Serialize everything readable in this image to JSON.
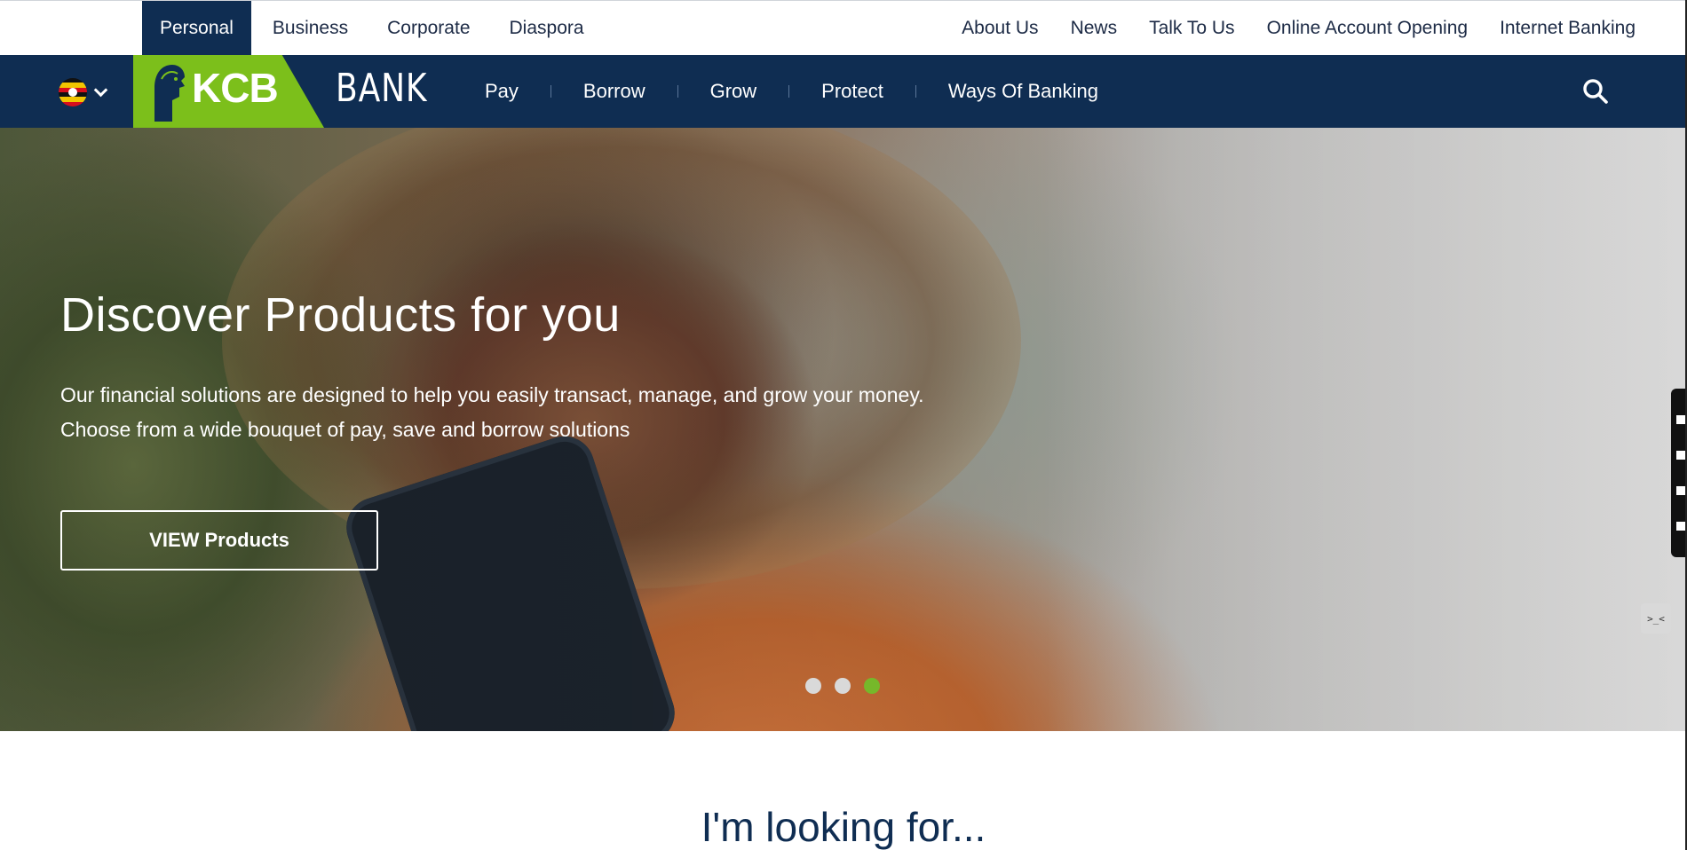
{
  "segments": [
    {
      "label": "Personal",
      "active": true
    },
    {
      "label": "Business",
      "active": false
    },
    {
      "label": "Corporate",
      "active": false
    },
    {
      "label": "Diaspora",
      "active": false
    }
  ],
  "utility_links": [
    "About Us",
    "News",
    "Talk To Us",
    "Online Account Opening",
    "Internet Banking"
  ],
  "country_selector": {
    "icon": "uganda-flag-icon"
  },
  "logo": {
    "kcb": "KCB",
    "bank": "BANK"
  },
  "nav": [
    "Pay",
    "Borrow",
    "Grow",
    "Protect",
    "Ways Of Banking"
  ],
  "hero": {
    "title": "Discover Products for you",
    "text": "Our financial solutions are designed to help you easily transact, manage, and grow your money. Choose from a wide bouquet of pay, save and borrow solutions",
    "button": "VIEW Products",
    "slides_total": 3,
    "active_slide": 3
  },
  "devtools_tab": ">_<",
  "section": {
    "heading": "I'm looking for..."
  },
  "colors": {
    "navy": "#0f2d52",
    "green": "#7cbf1b",
    "dot_active": "#76b82a"
  }
}
